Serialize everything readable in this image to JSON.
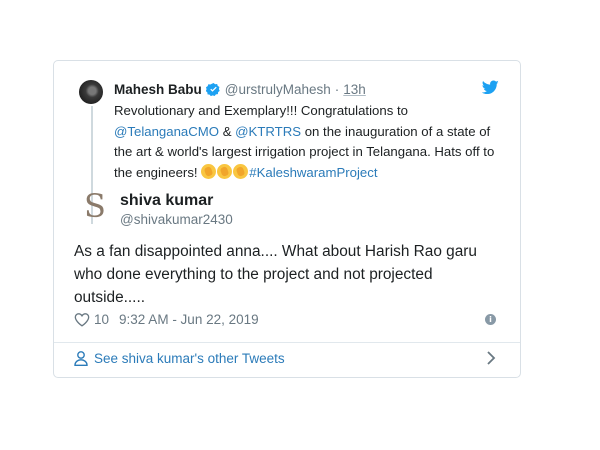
{
  "parent_tweet": {
    "author_name": "Mahesh Babu",
    "author_handle": "@urstrulyMahesh",
    "separator": "·",
    "time": "13h",
    "text_segments": [
      {
        "type": "text",
        "value": "Revolutionary and Exemplary!!! Congratulations to "
      },
      {
        "type": "mention",
        "value": "@TelanganaCMO"
      },
      {
        "type": "text",
        "value": " & "
      },
      {
        "type": "mention",
        "value": "@KTRTRS"
      },
      {
        "type": "text",
        "value": " on the inauguration of a state of the art & world's largest irrigation project in Telangana. Hats off to the engineers! "
      },
      {
        "type": "emoji",
        "value": "clapping-hands"
      },
      {
        "type": "emoji",
        "value": "clapping-hands"
      },
      {
        "type": "emoji",
        "value": "clapping-hands"
      },
      {
        "type": "hashtag",
        "value": "#KaleshwaramProject"
      }
    ]
  },
  "reply_tweet": {
    "author_name": "shiva kumar",
    "author_handle": "@shivakumar2430",
    "avatar_letter": "S",
    "text": "As a fan disappointed anna.... What about Harish Rao garu who done everything to the project and not projected outside.....",
    "like_count": "10",
    "timestamp": "9:32 AM - Jun 22, 2019",
    "info_glyph": "i"
  },
  "footer": {
    "link_text": "See shiva kumar's other Tweets"
  },
  "colors": {
    "link": "#2b7bb9",
    "muted": "#697882",
    "border": "#d9e0e6",
    "twitter_blue": "#1da1f2"
  }
}
